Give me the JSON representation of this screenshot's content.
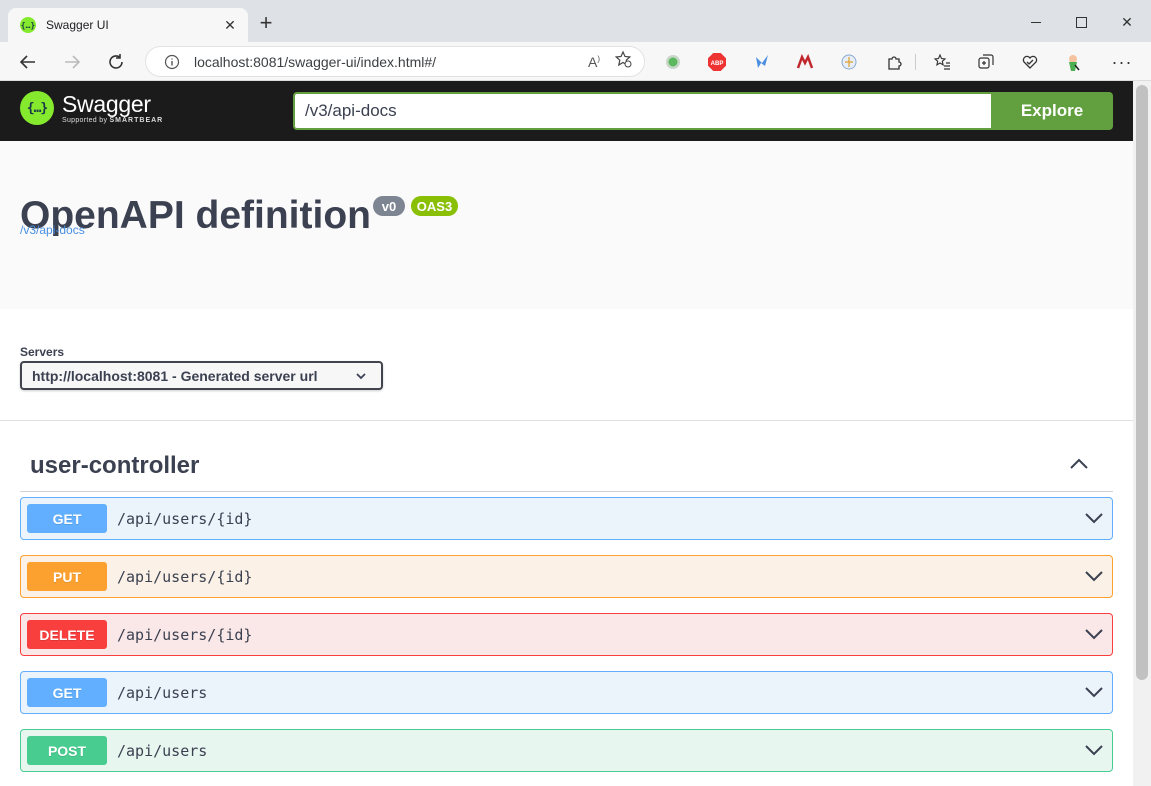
{
  "browser": {
    "tab_title": "Swagger UI",
    "url": "localhost:8081/swagger-ui/index.html#/"
  },
  "topbar": {
    "brand": "Swagger",
    "supported_by": "Supported by",
    "smartbear": "SMARTBEAR",
    "spec_url": "/v3/api-docs",
    "explore_label": "Explore"
  },
  "info": {
    "title": "OpenAPI definition",
    "version": "v0",
    "oas": "OAS3",
    "spec_link": "/v3/api-docs"
  },
  "servers": {
    "label": "Servers",
    "selected": "http://localhost:8081 - Generated server url"
  },
  "tag": {
    "name": "user-controller"
  },
  "operations": [
    {
      "method": "GET",
      "path": "/api/users/{id}"
    },
    {
      "method": "PUT",
      "path": "/api/users/{id}"
    },
    {
      "method": "DELETE",
      "path": "/api/users/{id}"
    },
    {
      "method": "GET",
      "path": "/api/users"
    },
    {
      "method": "POST",
      "path": "/api/users"
    }
  ],
  "colors": {
    "get": "#61affe",
    "put": "#fca130",
    "delete": "#f93e3e",
    "post": "#49cc90",
    "explore": "#62a03f",
    "topbar": "#1b1b1b"
  }
}
